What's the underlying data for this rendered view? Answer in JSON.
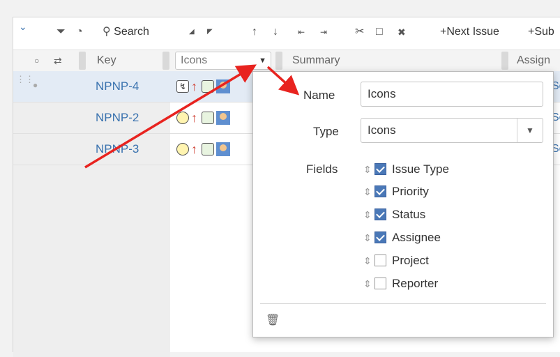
{
  "toolbar": {
    "search_label": "Search",
    "next_issue_label": "+Next Issue",
    "sub_label": "+Sub"
  },
  "columns": {
    "key": "Key",
    "icons": "Icons",
    "summary": "Summary",
    "assignee": "Assign"
  },
  "rows": [
    {
      "key": "NPNP-4",
      "assignee": "Se",
      "selected": true
    },
    {
      "key": "NPNP-2",
      "assignee": "Se",
      "selected": false
    },
    {
      "key": "NPNP-3",
      "assignee": "Se",
      "selected": false
    }
  ],
  "popup": {
    "name_label": "Name",
    "name_value": "Icons",
    "type_label": "Type",
    "type_value": "Icons",
    "fields_label": "Fields",
    "fields": [
      {
        "label": "Issue Type",
        "checked": true
      },
      {
        "label": "Priority",
        "checked": true
      },
      {
        "label": "Status",
        "checked": true
      },
      {
        "label": "Assignee",
        "checked": true
      },
      {
        "label": "Project",
        "checked": false
      },
      {
        "label": "Reporter",
        "checked": false
      }
    ]
  },
  "colors": {
    "link": "#3b73af",
    "priority": "#d04437",
    "annotation_arrow": "#e8231f",
    "checkbox": "#4a78b7"
  }
}
